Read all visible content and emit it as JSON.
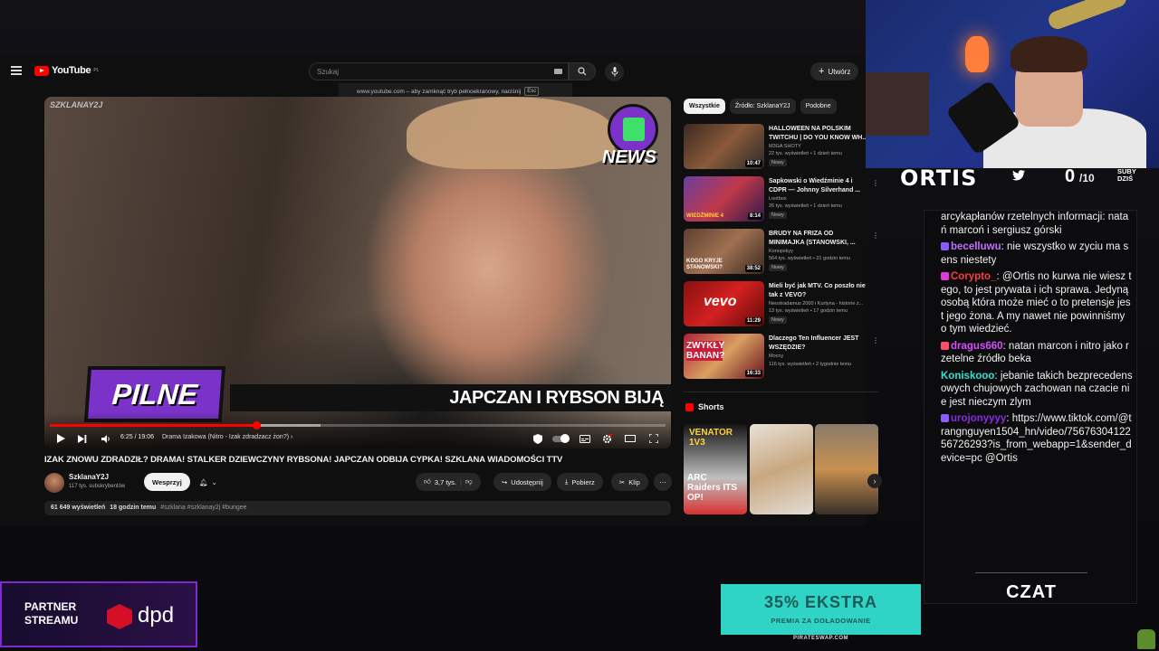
{
  "youtube": {
    "logo_text": "YouTube",
    "logo_region": "PL",
    "search_placeholder": "Szukaj",
    "create_label": "Utwórz",
    "fullscreen_tip": "www.youtube.com – aby zamknąć tryb pełnoekranowy, naciśnij",
    "fullscreen_key": "Esc"
  },
  "player": {
    "channel_watermark": "SZKLANAY2J",
    "badge_text": "NEWS",
    "pilne_text": "PILNE",
    "headline_text": "JAPCZAN I RYBSON BIJĄ",
    "time": "6:25 / 19:06",
    "chapter": "Drama Izakowa (Nitro - Izak zdradzacz żon?)",
    "progress": 0.336,
    "buffered": 0.44
  },
  "video": {
    "title": "IZAK ZNOWU ZDRADZIŁ? DRAMA! STALKER DZIEWCZYNY RYBSONA! JAPCZAN ODBIJA CYPKA! SZKLANA WIADOMOŚCI TTV",
    "channel": "SzklanaY2J",
    "subscribers": "117 tys. subskrybentów",
    "support_label": "Wesprzyj",
    "likes": "3,7 tys.",
    "share_label": "Udostępnij",
    "download_label": "Pobierz",
    "clip_label": "Klip",
    "views": "61 649 wyświetleń",
    "ago": "18 godzin temu",
    "tags": "#szklana #szklanay2j #bungee"
  },
  "sidebar": {
    "chips": [
      "Wszystkie",
      "Źródło: SzklanaY2J",
      "Podobne"
    ],
    "recommended": [
      {
        "title": "HALLOWEEN NA POLSKIM TWITCHU | DO YOU KNOW WH...",
        "channel": "M3GA SHOTY",
        "meta": "22 tys. wyświetleń • 1 dzień temu",
        "badge": "Nowy",
        "duration": "10:47",
        "thumb_color": "#3b2a1f"
      },
      {
        "title": "Sapkowski o Wiedźminie 4 i CDPR — Johnny Silverhand ...",
        "channel": "Lootbox",
        "meta": "26 tys. wyświetleń • 1 dzień temu",
        "badge": "Nowy",
        "duration": "8:14",
        "thumb_color": "#5a3d86"
      },
      {
        "title": "BRUDY NA FRIZA OD MINIMAJKA (STANOWSKI, ...",
        "channel": "Konopskyy",
        "meta": "564 tys. wyświetleń • 21 godzin temu",
        "badge": "Nowy",
        "duration": "38:52",
        "thumb_color": "#5c4030"
      },
      {
        "title": "Mieli być jak MTV. Co poszło nie tak z VEVO?",
        "channel": "Neostradamus 2000 i Kurtyna - historie z...",
        "meta": "13 tys. wyświetleń • 17 godzin temu",
        "badge": "Nowy",
        "duration": "11:29",
        "thumb_color": "#c41818"
      },
      {
        "title": "Dlaczego Ten Influencer JEST WSZĘDZIE?",
        "channel": "Mocny",
        "meta": "116 tys. wyświetleń • 2 tygodnie temu",
        "badge": "",
        "duration": "16:33",
        "thumb_color": "#b0203a"
      }
    ],
    "rec_thumb_texts": [
      "",
      "WIEDŹMINIE 4",
      "KOGO KRYJE STANOWSKI?",
      "vevo",
      "ZWYKŁY BANAN?"
    ],
    "shorts_label": "Shorts",
    "shorts_texts": [
      "VENATOR 1V3",
      "ARC Raiders ITS OP!"
    ]
  },
  "overlay": {
    "streamer": "ORTIS",
    "subs_count": "0",
    "subs_goal": "/10",
    "subs_label_1": "SUBY",
    "subs_label_2": "DZIŚ",
    "chat_title": "CZAT",
    "chat": [
      {
        "user": "",
        "color": "#ffffff",
        "text": "arcykapłanów rzetelnych informacji: natań marcoń i sergiusz górski",
        "badge": ""
      },
      {
        "user": "becelluwu",
        "color": "#c46dff",
        "text": "nie wszystko w zyciu ma sens niestety",
        "badge": "#8a5cff"
      },
      {
        "user": "Corypto_",
        "color": "#ff3b3b",
        "text": "@Ortis no kurwa nie wiesz tego, to jest prywata i ich sprawa. Jedyną osobą która może mieć o to pretensje jest jego żona. A my nawet nie powinniśmy o tym wiedzieć.",
        "badge": "#e23ad6"
      },
      {
        "user": "dragus660",
        "color": "#d84dff",
        "text": "natan marcon i nitro jako rzetelne źródło beka",
        "badge": "#ff4d6d"
      },
      {
        "user": "Koniskooo",
        "color": "#35e0d0",
        "text": "jebanie takich bezprecedensowych chujowych zachowan na czacie nie jest nieczym zlym",
        "badge": ""
      },
      {
        "user": "urojonyyyy",
        "color": "#8a2be2",
        "text": "https://www.tiktok.com/@trangnguyen1504_hn/video/7567630412256726293?is_from_webapp=1&sender_device=pc @Ortis",
        "badge": "#8a5cff"
      }
    ],
    "partner_line1": "PARTNER",
    "partner_line2": "STREAMU",
    "partner_brand": "dpd",
    "promo_big": "35% EKSTRA",
    "promo_small": "PREMIA ZA DOŁADOWANIE",
    "promo_url": "PIRATESWAP.COM"
  }
}
